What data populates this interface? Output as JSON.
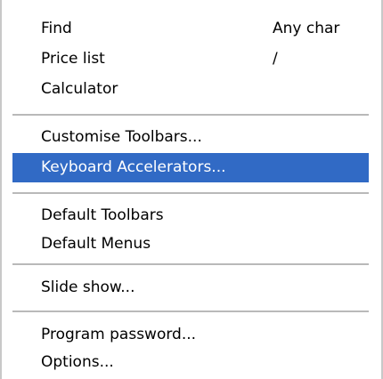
{
  "menu": {
    "items": [
      {
        "label": "Find",
        "shortcut": "Any char"
      },
      {
        "label": "Price list",
        "shortcut": "/"
      },
      {
        "label": "Calculator",
        "shortcut": ""
      },
      {
        "label": "Customise Toolbars...",
        "shortcut": ""
      },
      {
        "label": "Keyboard Accelerators...",
        "shortcut": ""
      },
      {
        "label": "Default Toolbars",
        "shortcut": ""
      },
      {
        "label": "Default Menus",
        "shortcut": ""
      },
      {
        "label": "Slide show...",
        "shortcut": ""
      },
      {
        "label": "Program password...",
        "shortcut": ""
      },
      {
        "label": "Options...",
        "shortcut": ""
      }
    ],
    "selected_label": "Keyboard Accelerators..."
  },
  "colors": {
    "highlight": "#316ac5",
    "highlight_text": "#ffffff",
    "separator": "#b9b9b9"
  }
}
